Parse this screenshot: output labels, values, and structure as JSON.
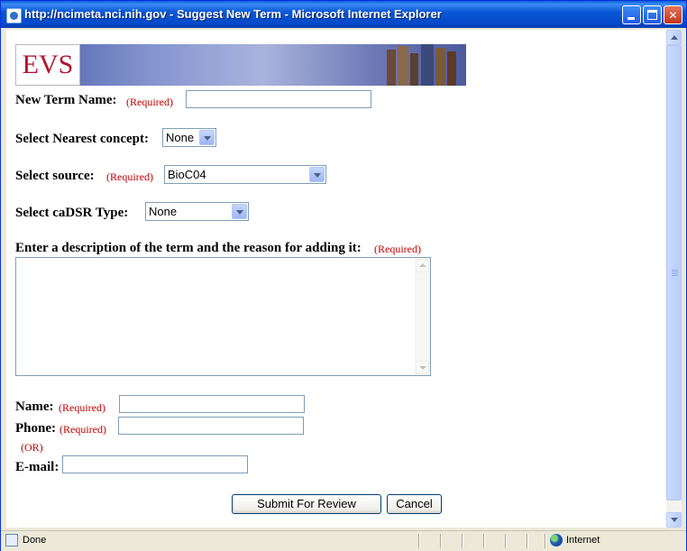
{
  "window": {
    "title": "http://ncimeta.nci.nih.gov - Suggest New Term - Microsoft Internet Explorer",
    "controls": [
      "minimize-icon",
      "maximize-icon",
      "close-icon"
    ]
  },
  "banner": {
    "logo_text": "EVS"
  },
  "form": {
    "required_marker": "(Required)",
    "new_term": {
      "label": "New Term Name:",
      "value": ""
    },
    "nearest_concept": {
      "label": "Select Nearest concept:",
      "selected": "None"
    },
    "source": {
      "label": "Select source:",
      "selected": "BioC04"
    },
    "cadsr_type": {
      "label": "Select caDSR Type:",
      "selected": "None"
    },
    "description": {
      "label": "Enter a description of the term and the reason for adding it:",
      "value": ""
    },
    "name": {
      "label": "Name:",
      "value": ""
    },
    "phone": {
      "label": "Phone:",
      "value": ""
    },
    "or_text": "(OR)",
    "email": {
      "label": "E-mail:",
      "value": ""
    },
    "submit_label": "Submit For Review",
    "cancel_label": "Cancel"
  },
  "statusbar": {
    "status": "Done",
    "zone": "Internet"
  },
  "colors": {
    "required": "#c00000",
    "titlebar": "#0a58d7",
    "border": "#7f9db9"
  }
}
